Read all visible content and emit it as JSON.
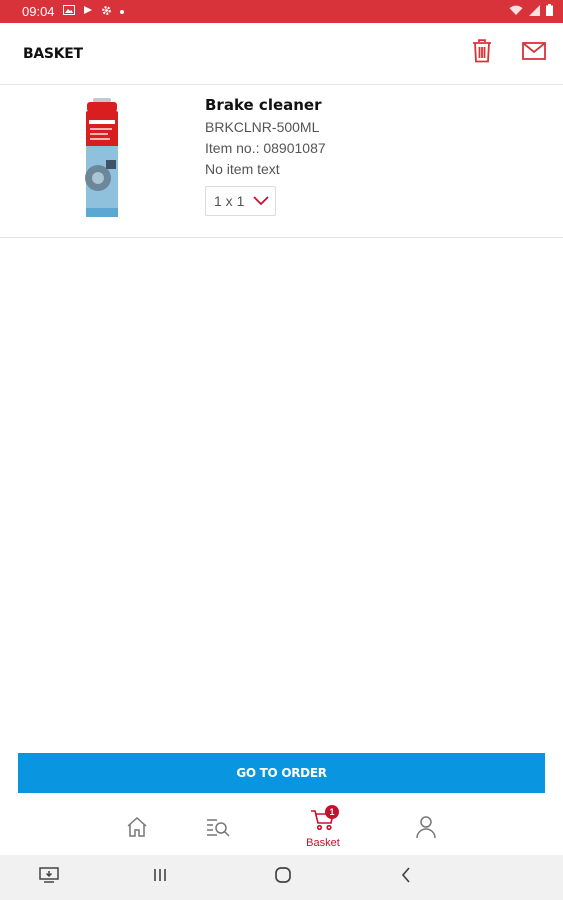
{
  "status_bar": {
    "time": "09:04",
    "icons": [
      "image-icon",
      "play-store-icon",
      "settings-icon",
      "dot-icon",
      "wifi-icon",
      "signal-icon",
      "battery-icon"
    ]
  },
  "header": {
    "title": "BASKET",
    "actions": [
      "trash-icon",
      "mail-icon"
    ]
  },
  "basket": {
    "items": [
      {
        "name": "Brake cleaner",
        "code": "BRKCLNR-500ML",
        "item_no": "Item no.: 08901087",
        "item_text": "No item text",
        "quantity": "1 x 1"
      }
    ]
  },
  "actions": {
    "order_label": "GO TO ORDER"
  },
  "bottom_nav": {
    "items": [
      "home-icon",
      "catalog-search-icon",
      "basket-icon",
      "account-icon"
    ],
    "active_label": "Basket",
    "badge": "1"
  },
  "colors": {
    "brand_red": "#d8333b",
    "accent_red": "#c8102e",
    "primary_blue": "#0a95e0"
  }
}
